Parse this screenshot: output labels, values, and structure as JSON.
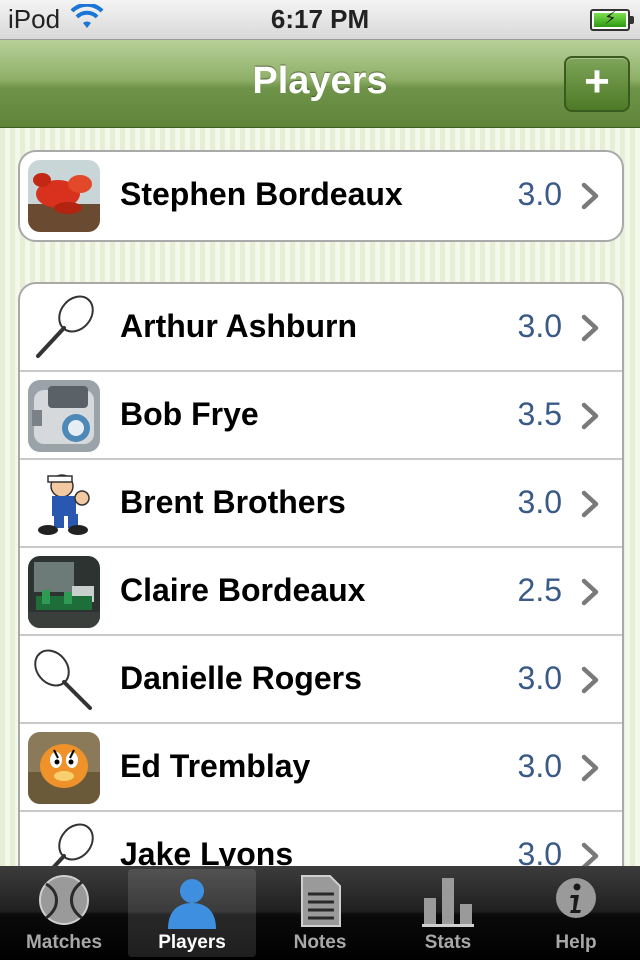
{
  "status_bar": {
    "carrier": "iPod",
    "time": "6:17 PM"
  },
  "nav_bar": {
    "title": "Players",
    "add_label": "+"
  },
  "my_player": {
    "name": "Stephen Bordeaux",
    "rating": "3.0",
    "avatar": "lobster-photo"
  },
  "players": [
    {
      "name": "Arthur Ashburn",
      "rating": "3.0",
      "avatar": "racket-icon"
    },
    {
      "name": "Bob Frye",
      "rating": "3.5",
      "avatar": "train-photo"
    },
    {
      "name": "Brent Brothers",
      "rating": "3.0",
      "avatar": "cartoon-sailor"
    },
    {
      "name": "Claire Bordeaux",
      "rating": "2.5",
      "avatar": "room-photo"
    },
    {
      "name": "Danielle Rogers",
      "rating": "3.0",
      "avatar": "racket-icon"
    },
    {
      "name": "Ed Tremblay",
      "rating": "3.0",
      "avatar": "cartoon-cat"
    },
    {
      "name": "Jake Lyons",
      "rating": "3.0",
      "avatar": "racket-icon"
    }
  ],
  "tabs": [
    {
      "label": "Matches",
      "icon": "tennis-ball-icon"
    },
    {
      "label": "Players",
      "icon": "person-icon",
      "active": true
    },
    {
      "label": "Notes",
      "icon": "document-icon"
    },
    {
      "label": "Stats",
      "icon": "bar-chart-icon"
    },
    {
      "label": "Help",
      "icon": "info-icon"
    }
  ],
  "colors": {
    "nav_green": "#7a9e52",
    "rating_blue": "#3a5a88",
    "tab_active_blue": "#3f8fe0"
  }
}
